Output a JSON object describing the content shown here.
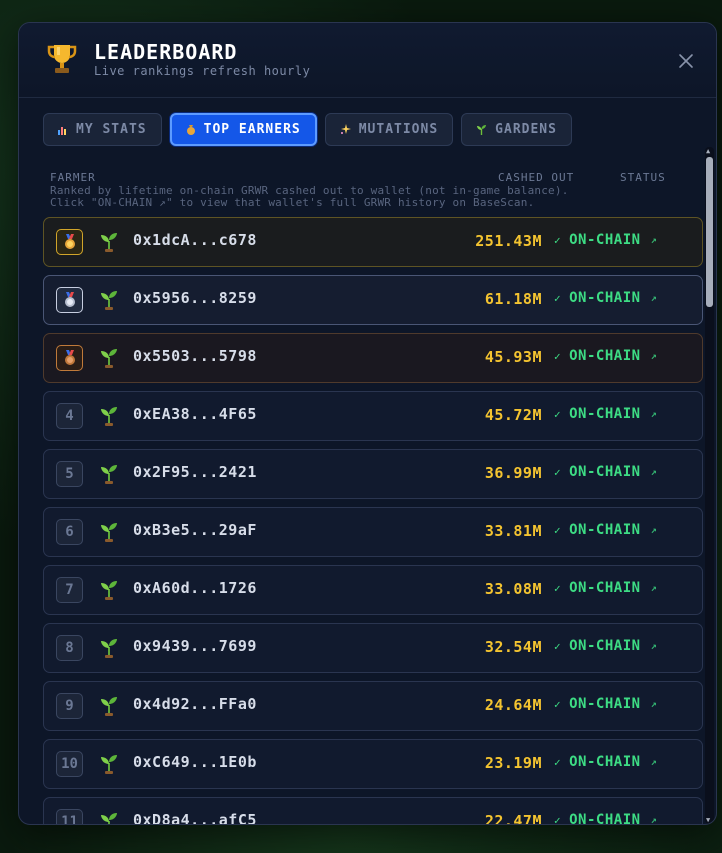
{
  "header": {
    "title": "LEADERBOARD",
    "subtitle": "Live rankings refresh hourly"
  },
  "tabs": [
    {
      "label": "MY STATS",
      "icon": "chart-icon",
      "active": false
    },
    {
      "label": "TOP EARNERS",
      "icon": "money-bag-icon",
      "active": true
    },
    {
      "label": "MUTATIONS",
      "icon": "sparkles-icon",
      "active": false
    },
    {
      "label": "GARDENS",
      "icon": "sprout-icon",
      "active": false
    }
  ],
  "columns": {
    "farmer": "FARMER",
    "cashed_out": "CASHED OUT",
    "status": "STATUS"
  },
  "description": {
    "line1": "Ranked by lifetime on-chain GRWR cashed out to wallet (not in-game balance).",
    "line2": "Click \"ON-CHAIN ↗\" to view that wallet's full GRWR history on BaseScan."
  },
  "rows": [
    {
      "rank": "1",
      "medal": "gold-medal-icon",
      "address": "0x1dcA...c678",
      "amount": "251.43M",
      "status": "ON-CHAIN"
    },
    {
      "rank": "2",
      "medal": "silver-medal-icon",
      "address": "0x5956...8259",
      "amount": "61.18M",
      "status": "ON-CHAIN"
    },
    {
      "rank": "3",
      "medal": "bronze-medal-icon",
      "address": "0x5503...5798",
      "amount": "45.93M",
      "status": "ON-CHAIN"
    },
    {
      "rank": "4",
      "address": "0xEA38...4F65",
      "amount": "45.72M",
      "status": "ON-CHAIN"
    },
    {
      "rank": "5",
      "address": "0x2F95...2421",
      "amount": "36.99M",
      "status": "ON-CHAIN"
    },
    {
      "rank": "6",
      "address": "0xB3e5...29aF",
      "amount": "33.81M",
      "status": "ON-CHAIN"
    },
    {
      "rank": "7",
      "address": "0xA60d...1726",
      "amount": "33.08M",
      "status": "ON-CHAIN"
    },
    {
      "rank": "8",
      "address": "0x9439...7699",
      "amount": "32.54M",
      "status": "ON-CHAIN"
    },
    {
      "rank": "9",
      "address": "0x4d92...FFa0",
      "amount": "24.64M",
      "status": "ON-CHAIN"
    },
    {
      "rank": "10",
      "address": "0xC649...1E0b",
      "amount": "23.19M",
      "status": "ON-CHAIN"
    },
    {
      "rank": "11",
      "address": "0xD8a4...afC5",
      "amount": "22.47M",
      "status": "ON-CHAIN"
    }
  ],
  "colors": {
    "accent": "#1457e8",
    "amount": "#f4c430",
    "status": "#3ddc84",
    "panel": "#0d1628"
  }
}
